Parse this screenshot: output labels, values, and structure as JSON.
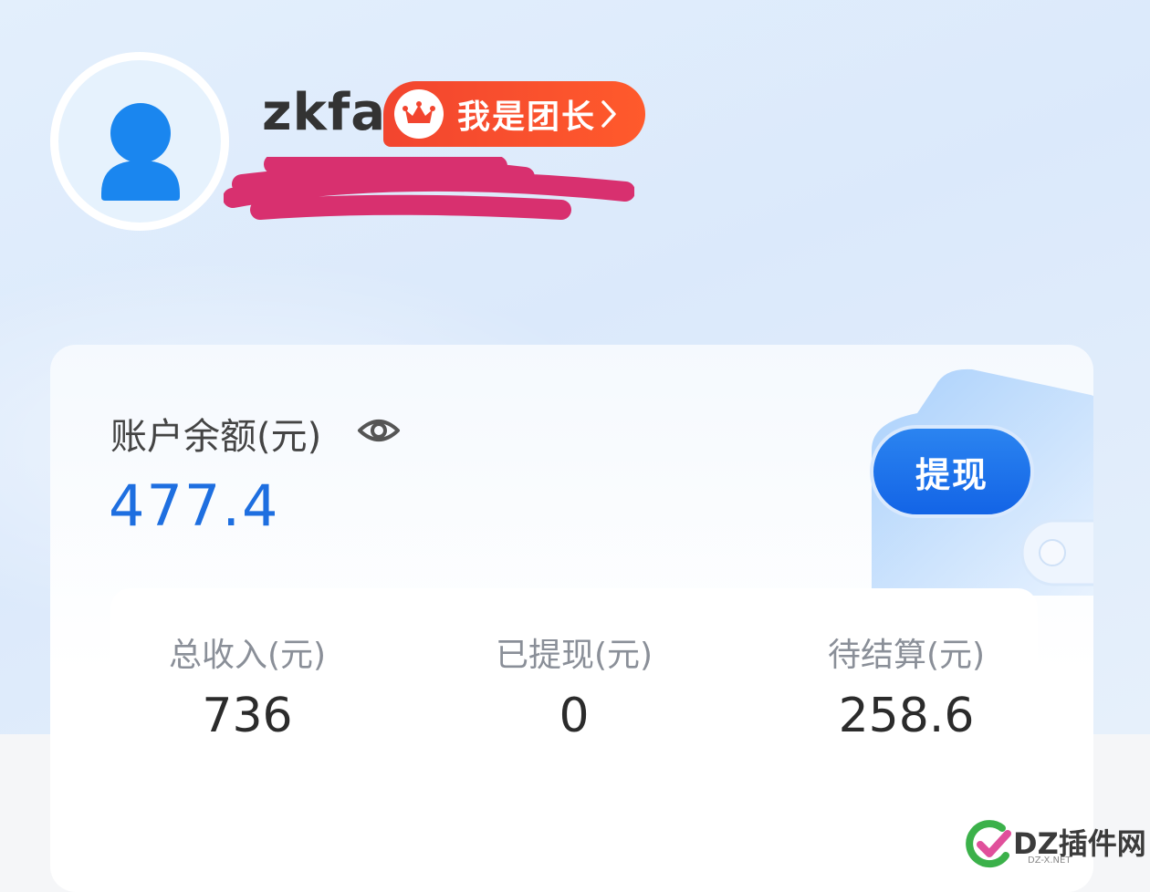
{
  "profile": {
    "username": "zkfa",
    "leader_badge": "我是团长"
  },
  "balance": {
    "label": "账户余额(元)",
    "value": "477.4",
    "withdraw_label": "提现"
  },
  "stats": [
    {
      "label": "总收入(元)",
      "value": "736"
    },
    {
      "label": "已提现(元)",
      "value": "0"
    },
    {
      "label": "待结算(元)",
      "value": "258.6"
    }
  ],
  "watermark": {
    "text": "DZ插件网",
    "sub": "DZ-X.NET"
  },
  "colors": {
    "accent": "#1e6fe0",
    "badge": "#f2452f",
    "redaction": "#d8306f"
  }
}
